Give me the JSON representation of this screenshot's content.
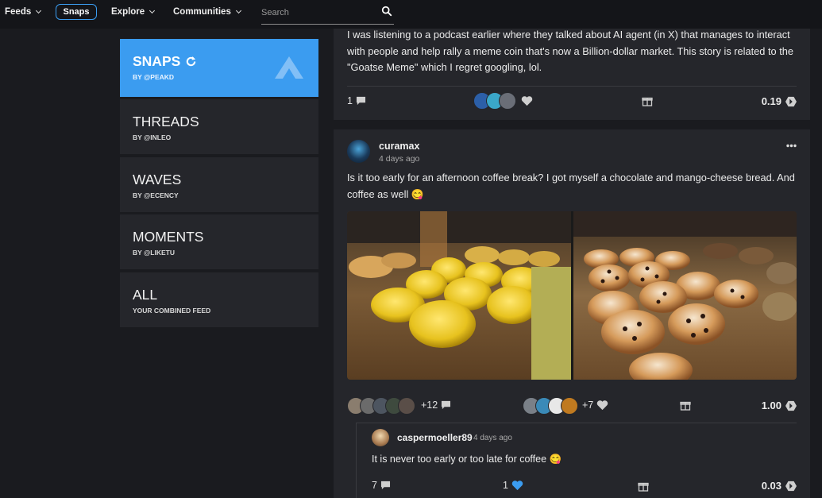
{
  "nav": {
    "feeds": "Feeds",
    "snaps": "Snaps",
    "explore": "Explore",
    "communities": "Communities",
    "search_placeholder": "Search"
  },
  "menu": [
    {
      "title": "SNAPS",
      "subtitle": "BY @PEAKD"
    },
    {
      "title": "THREADS",
      "subtitle": "BY @INLEO"
    },
    {
      "title": "WAVES",
      "subtitle": "BY @ECENCY"
    },
    {
      "title": "MOMENTS",
      "subtitle": "BY @LIKETU"
    },
    {
      "title": "ALL",
      "subtitle": "YOUR COMBINED FEED"
    }
  ],
  "post1": {
    "text": "I was listening to a podcast earlier where they talked about AI agent (in X) that manages to interact with people and help rally a meme coin that's now a Billion-dollar market. This story is related to the \"Goatse Meme\" which I regret googling, lol.",
    "comments": "1",
    "payout": "0.19"
  },
  "post2": {
    "author": "curamax",
    "time": "4 days ago",
    "text": "Is it too early for an afternoon coffee break? I got myself a chocolate and mango-cheese bread. And coffee as well 😋",
    "reblog_count": "+12",
    "like_count": "+7",
    "payout": "1.00"
  },
  "reply": {
    "author": "caspermoeller89",
    "time": "4 days ago",
    "text": "It is never too early or too late for coffee 😋",
    "comments": "7",
    "likes": "1",
    "payout": "0.03"
  },
  "colors": {
    "accent": "#3b9cf0",
    "background": "#1a1b1f",
    "card": "#25262b"
  }
}
